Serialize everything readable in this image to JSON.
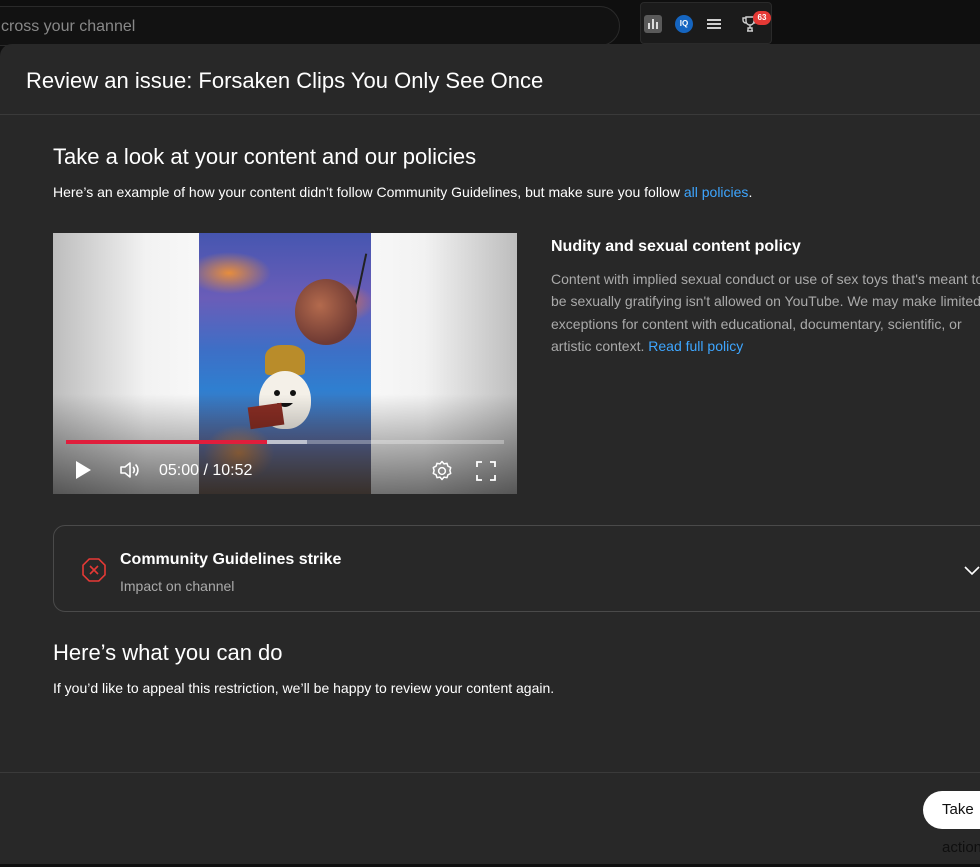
{
  "topbar": {
    "search_placeholder": "cross your channel",
    "extensions": {
      "iq_label": "IQ",
      "trophy_badge": "63"
    }
  },
  "dialog": {
    "title": "Review an issue: Forsaken Clips You Only See Once",
    "section1": {
      "title": "Take a look at your content and our policies",
      "desc_prefix": "Here’s an example of how your content didn’t follow Community Guidelines, but make sure you follow ",
      "desc_link": "all policies",
      "desc_suffix": "."
    },
    "video": {
      "time": "05:00 / 10:52",
      "progress_fraction": 0.4598,
      "buffered_fraction": 0.55
    },
    "policy": {
      "title": "Nudity and sexual content policy",
      "text": "Content with implied sexual conduct or use of sex toys that's meant to be sexually gratifying isn't allowed on YouTube. We may make limited exceptions for content with educational, documentary, scientific, or artistic context. ",
      "link": "Read full policy"
    },
    "strike": {
      "title": "Community Guidelines strike",
      "subtitle": "Impact on channel"
    },
    "section2": {
      "title": "Here’s what you can do",
      "desc": "If you’d like to appeal this restriction, we’ll be happy to review your content again."
    },
    "footer": {
      "action_label": "Take action"
    }
  },
  "colors": {
    "dialog_bg": "#282828",
    "link": "#3ea6ff",
    "progress_played": "#e01e3c",
    "strike_icon": "#e53935"
  }
}
